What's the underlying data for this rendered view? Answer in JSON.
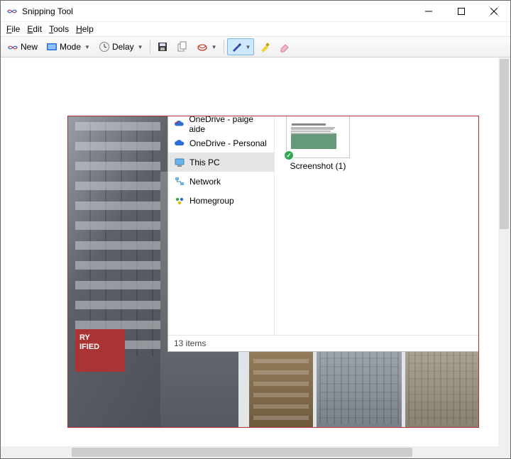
{
  "window": {
    "title": "Snipping Tool"
  },
  "menubar": {
    "items": [
      {
        "key": "F",
        "rest": "ile"
      },
      {
        "key": "E",
        "rest": "dit"
      },
      {
        "key": "T",
        "rest": "ools"
      },
      {
        "key": "H",
        "rest": "elp"
      }
    ]
  },
  "toolbar": {
    "new_label": "New",
    "mode_label": "Mode",
    "delay_label": "Delay"
  },
  "explorer": {
    "nav": [
      {
        "label": "OneDrive - paige aide",
        "icon": "cloud-blue"
      },
      {
        "label": "OneDrive - Personal",
        "icon": "cloud-blue"
      },
      {
        "label": "This PC",
        "icon": "pc",
        "selected": true
      },
      {
        "label": "Network",
        "icon": "network"
      },
      {
        "label": "Homegroup",
        "icon": "homegroup"
      }
    ],
    "files": [
      {
        "label": "Screenshot (1)"
      }
    ],
    "status": "13 items"
  },
  "photo": {
    "sign_text": "RY\nIFIED"
  }
}
